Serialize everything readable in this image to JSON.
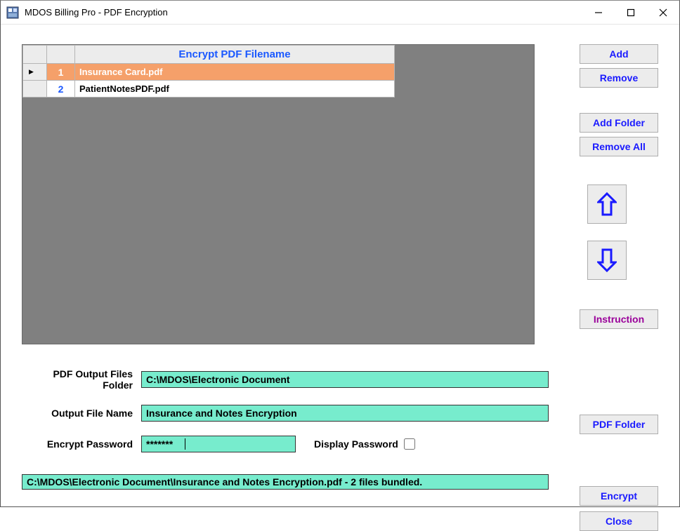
{
  "window": {
    "title": "MDOS Billing Pro - PDF Encryption"
  },
  "grid": {
    "header": "Encrypt PDF Filename",
    "rows": [
      {
        "num": "1",
        "name": "Insurance Card.pdf",
        "selected": true
      },
      {
        "num": "2",
        "name": "PatientNotesPDF.pdf",
        "selected": false
      }
    ]
  },
  "buttons": {
    "add": "Add",
    "remove": "Remove",
    "addFolder": "Add Folder",
    "removeAll": "Remove All",
    "instruction": "Instruction",
    "pdfFolder": "PDF Folder",
    "encrypt": "Encrypt",
    "close": "Close"
  },
  "form": {
    "outputFolderLabel": "PDF Output Files Folder",
    "outputFolderValue": "C:\\MDOS\\Electronic Document",
    "outputNameLabel": "Output File Name",
    "outputNameValue": "Insurance and Notes Encryption",
    "passwordLabel": "Encrypt Password",
    "passwordValue": "*******",
    "displayPwdLabel": "Display Password"
  },
  "status": "C:\\MDOS\\Electronic Document\\Insurance and Notes Encryption.pdf - 2 files bundled."
}
